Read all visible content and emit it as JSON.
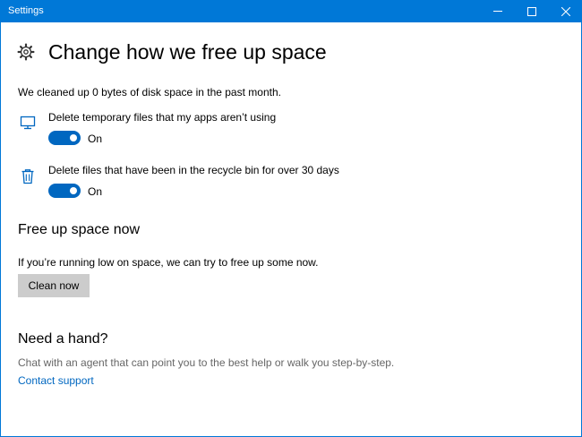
{
  "window": {
    "title": "Settings",
    "controls": [
      "minimize-icon",
      "maximize-icon",
      "close-icon"
    ]
  },
  "header": {
    "icon": "gear-icon",
    "title": "Change how we free up space"
  },
  "storage_sense": {
    "summary": "We cleaned up 0 bytes of disk space in the past month.",
    "options": [
      {
        "icon": "monitor-icon",
        "label": "Delete temporary files that my apps aren’t using",
        "state": "On",
        "enabled": true
      },
      {
        "icon": "recycle-bin-icon",
        "label": "Delete files that have been in the recycle bin for over 30 days",
        "state": "On",
        "enabled": true
      }
    ]
  },
  "free_up": {
    "heading": "Free up space now",
    "description": "If you’re running low on space, we can try to free up some now.",
    "button_label": "Clean now"
  },
  "help": {
    "heading": "Need a hand?",
    "description": "Chat with an agent that can point you to the best help or walk you step-by-step.",
    "link_label": "Contact support"
  },
  "colors": {
    "titlebar": "#0078d7",
    "accent": "#0067c0",
    "button": "#cccccc",
    "muted_text": "#666666"
  }
}
